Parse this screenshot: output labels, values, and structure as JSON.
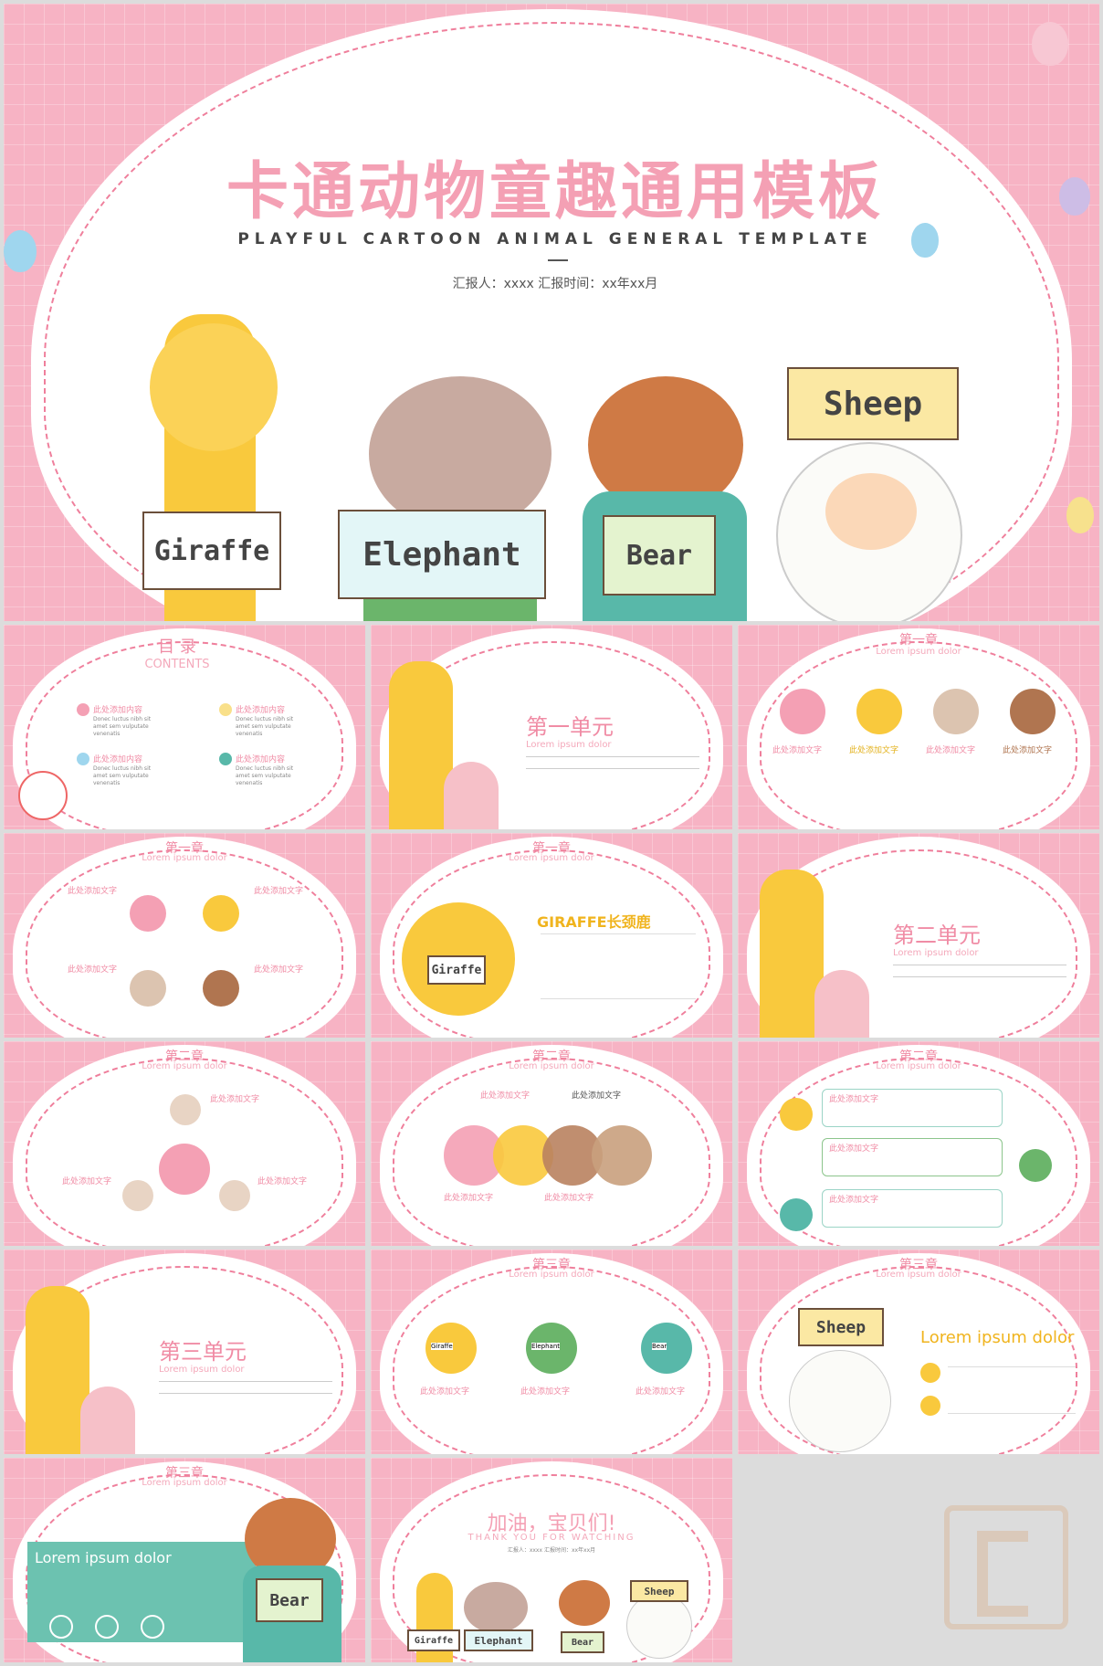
{
  "hero": {
    "title": "卡通动物童趣通用模板",
    "subtitle": "PLAYFUL CARTOON ANIMAL GENERAL TEMPLATE",
    "meta": "汇报人：xxxx    汇报时间：xx年xx月",
    "labels": [
      "Giraffe",
      "Elephant",
      "Bear",
      "Sheep"
    ]
  },
  "slide2": {
    "title": "目 录",
    "subtitle": "CONTENTS",
    "items": [
      "此处添加内容",
      "此处添加内容",
      "此处添加内容",
      "此处添加内容"
    ],
    "desc": "Donec luctus nibh sit amet sem vulputate venenatis"
  },
  "slide3": {
    "title": "第一单元",
    "sub": "Lorem ipsum dolor"
  },
  "chapter1": {
    "title": "第一章",
    "sub": "Lorem ipsum dolor"
  },
  "slide4": {
    "labels": [
      "此处添加文字",
      "此处添加文字",
      "此处添加文字",
      "此处添加文字"
    ]
  },
  "slide5": {
    "labels": [
      "此处添加文字",
      "此处添加文字",
      "此处添加文字",
      "此处添加文字"
    ]
  },
  "slide6": {
    "heading": "GIRAFFE长颈鹿",
    "sign": "Giraffe"
  },
  "slide7": {
    "title": "第二单元",
    "sub": "Lorem ipsum dolor"
  },
  "chapter2": {
    "title": "第二章",
    "sub": "Lorem ipsum dolor"
  },
  "slide8": {
    "labels": [
      "此处添加文字",
      "此处添加文字",
      "此处添加文字"
    ]
  },
  "slide9": {
    "labels": [
      "此处添加文字",
      "此处添加文字",
      "此处添加文字",
      "此处添加文字"
    ]
  },
  "slide10": {
    "labels": [
      "此处添加文字",
      "此处添加文字",
      "此处添加文字"
    ],
    "signs": [
      "Giraffe",
      "Elephant",
      "Bear"
    ]
  },
  "slide11": {
    "title": "第三单元",
    "sub": "Lorem ipsum dolor"
  },
  "chapter3": {
    "title": "第三章",
    "sub": "Lorem ipsum dolor"
  },
  "slide12": {
    "labels": [
      "此处添加文字",
      "此处添加文字",
      "此处添加文字"
    ],
    "signs": [
      "Giraffe",
      "Elephant",
      "Bear"
    ]
  },
  "slide13": {
    "heading": "Lorem ipsum dolor",
    "sign": "Sheep"
  },
  "slide14": {
    "heading": "Lorem ipsum dolor",
    "sign": "Bear"
  },
  "slide15": {
    "title": "加油，宝贝们!",
    "sub": "THANK YOU FOR WATCHING",
    "meta": "汇报人：xxxx  汇报时间：xx年xx月",
    "signs": [
      "Giraffe",
      "Elephant",
      "Bear",
      "Sheep"
    ]
  },
  "colors": {
    "pink": "#f08ca5",
    "bg": "#f7b3c4",
    "yellow": "#f9c93d",
    "brown": "#c9a07d",
    "teal": "#6cc2b0"
  }
}
